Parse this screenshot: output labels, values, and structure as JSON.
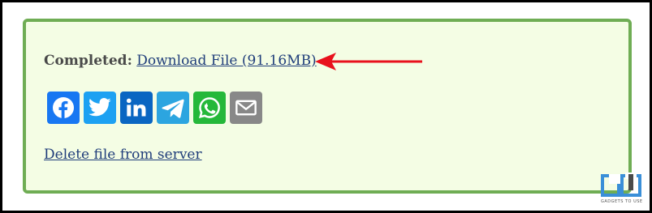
{
  "status": {
    "label": "Completed:",
    "download_link": "Download File (91.16MB)"
  },
  "share": {
    "buttons": [
      {
        "name": "facebook",
        "icon": "facebook-icon",
        "color": "#1877f2"
      },
      {
        "name": "twitter",
        "icon": "twitter-icon",
        "color": "#1da1f2"
      },
      {
        "name": "linkedin",
        "icon": "linkedin-icon",
        "color": "#0a66c2"
      },
      {
        "name": "telegram",
        "icon": "telegram-icon",
        "color": "#2ca5e0"
      },
      {
        "name": "whatsapp",
        "icon": "whatsapp-icon",
        "color": "#25d366"
      },
      {
        "name": "email",
        "icon": "mail-icon",
        "color": "#888888"
      }
    ]
  },
  "delete_link": "Delete file from server",
  "annotation": {
    "icon": "red-arrow-icon",
    "color": "#e8111c"
  },
  "watermark": {
    "text": "GADGETS TO USE"
  },
  "colors": {
    "panel_bg": "#f4fde4",
    "panel_border": "#6fad54",
    "link": "#1f3d7a"
  }
}
